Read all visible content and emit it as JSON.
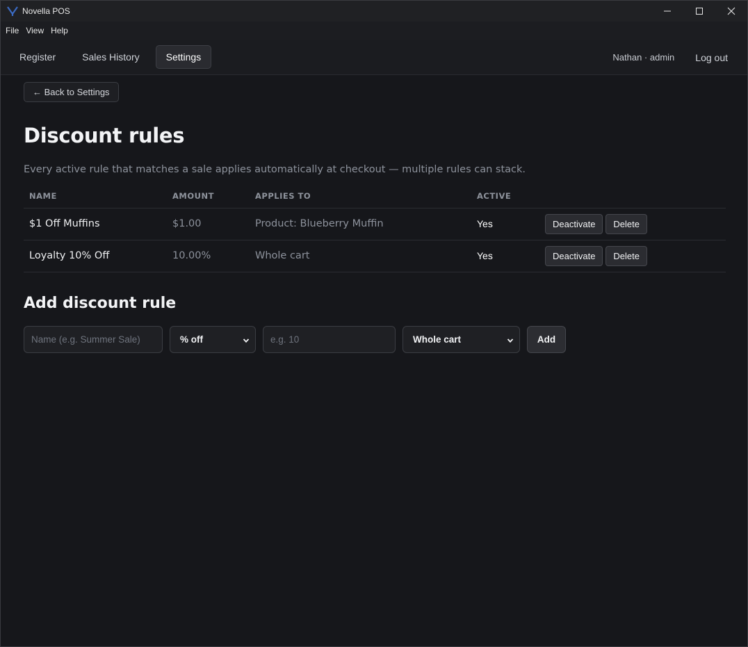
{
  "window": {
    "title": "Novella POS"
  },
  "menu": {
    "file": "File",
    "view": "View",
    "help": "Help"
  },
  "nav": {
    "tabs": [
      {
        "label": "Register"
      },
      {
        "label": "Sales History"
      },
      {
        "label": "Settings",
        "active": true
      }
    ],
    "user": "Nathan · admin",
    "logout": "Log out"
  },
  "page": {
    "back_label": "← Back to Settings",
    "title": "Discount rules",
    "description": "Every active rule that matches a sale applies automatically at checkout — multiple rules can stack."
  },
  "table": {
    "headers": {
      "name": "NAME",
      "amount": "AMOUNT",
      "applies_to": "APPLIES TO",
      "active": "ACTIVE"
    },
    "rows": [
      {
        "name": "$1 Off Muffins",
        "amount": "$1.00",
        "applies_to": "Product: Blueberry Muffin",
        "active": "Yes",
        "deactivate_label": "Deactivate",
        "delete_label": "Delete"
      },
      {
        "name": "Loyalty 10% Off",
        "amount": "10.00%",
        "applies_to": "Whole cart",
        "active": "Yes",
        "deactivate_label": "Deactivate",
        "delete_label": "Delete"
      }
    ]
  },
  "add_form": {
    "title": "Add discount rule",
    "name_placeholder": "Name (e.g. Summer Sale)",
    "type_value": "% off",
    "amount_placeholder": "e.g. 10",
    "scope_value": "Whole cart",
    "add_label": "Add"
  },
  "colors": {
    "background": "#16171b",
    "text_muted": "#8d929c",
    "button_bg": "#2b2c31",
    "app_icon": "#3b6bc4"
  }
}
